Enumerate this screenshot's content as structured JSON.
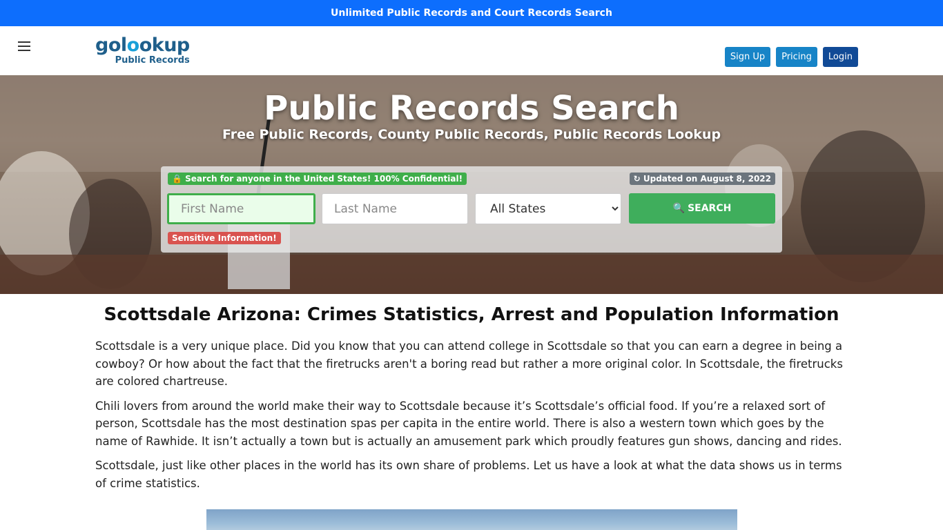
{
  "topbar": {
    "text": "Unlimited Public Records and Court Records Search"
  },
  "logo": {
    "main_a": "gol",
    "main_o": "o",
    "main_b": "okup",
    "sub": "Public Records"
  },
  "nav": {
    "signup": "Sign Up",
    "pricing": "Pricing",
    "login": "Login"
  },
  "hero": {
    "title": "Public Records Search",
    "subtitle": "Free Public Records, County Public Records, Public Records Lookup"
  },
  "search": {
    "confidential_badge": "Search for anyone in the United States! 100% Confidential!",
    "updated_badge": "Updated on August 8, 2022",
    "sensitive_badge": "Sensitive Information!",
    "first_name_placeholder": "First Name",
    "last_name_placeholder": "Last Name",
    "state_selected": "All States",
    "button_label": "SEARCH"
  },
  "article": {
    "heading": "Scottsdale Arizona: Crimes Statistics, Arrest and Population Information",
    "paragraphs": [
      "Scottsdale is a very unique place. Did you know that you can attend college in Scottsdale so that you can earn a degree in being a cowboy? Or how about the fact that the firetrucks aren't a boring read but rather a more original color. In Scottsdale, the firetrucks are colored chartreuse.",
      "Chili lovers from around the world make their way to Scottsdale because it’s Scottsdale’s official food. If you’re a relaxed sort of person, Scottsdale has the most destination spas per capita in the entire world. There is also a western town which goes by the name of Rawhide. It isn’t actually a town but is actually an amusement park which proudly features gun shows, dancing and rides.",
      "Scottsdale, just like other places in the world has its own share of problems. Let us have a look at what the data shows us in terms of crime statistics."
    ]
  },
  "colors": {
    "topbar": "#0d6efd",
    "accent_green": "#3fae4a",
    "nav_blue": "#1784c7",
    "nav_navy": "#114a96"
  },
  "icons": {
    "menu": "hamburger-icon",
    "lock": "lock-icon",
    "refresh": "refresh-icon",
    "search": "search-icon"
  }
}
